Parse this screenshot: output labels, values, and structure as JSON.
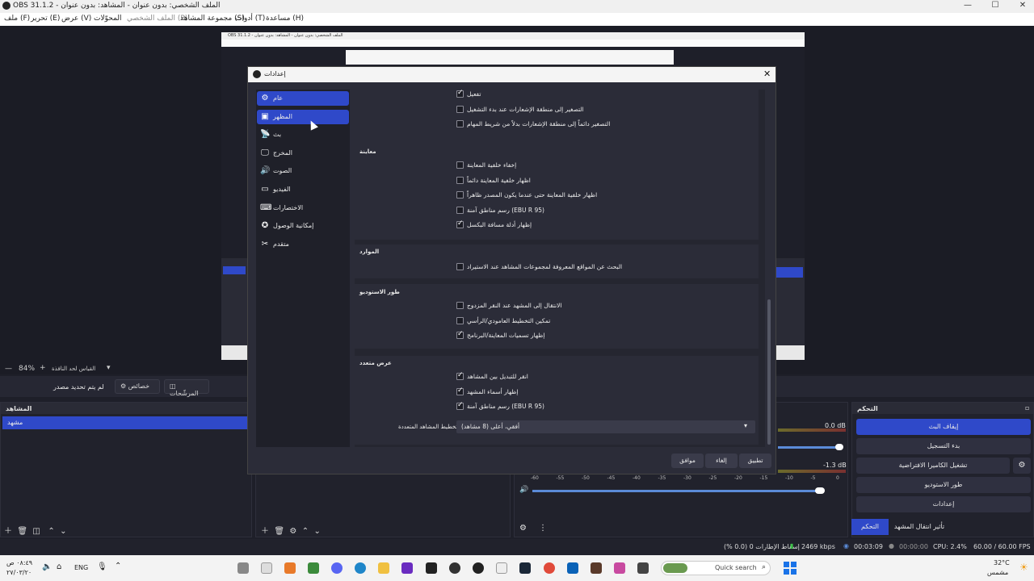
{
  "window": {
    "title": "OBS 31.1.2 - الملف الشخصي: بدون عنوان - المشاهد: بدون عنوان"
  },
  "menu": [
    "ملف (F)",
    "تحرير (E)",
    "عرض (V)",
    "المحوّلات",
    "الملف الشخصي (P)",
    "مجموعة المشاهد (S)",
    "أدوات (T)",
    "مساعدة (H)"
  ],
  "preview_title": "OBS 31.1.2 - الملف الشخصي: بدون عنوان - المشاهد: بدون عنوان",
  "zoom": {
    "value": "84%",
    "label": "القياس لحد النافذة"
  },
  "sourcebar": {
    "no_source": "لم يتم تحديد مصدر",
    "properties": "خصائص",
    "filters": "المرشّحات"
  },
  "scenes_panel": {
    "title": "المشاهد",
    "item": "مشهد"
  },
  "controls": {
    "title": "التحكم",
    "buttons": [
      "إيقاف البث",
      "بدء التسجيل",
      "تشغيل الكاميرا الافتراضية",
      "طور الاستوديو",
      "إعدادات"
    ],
    "tab_controls": "التحكم",
    "tab_transitions": "تأثير انتقال المشهد"
  },
  "audio": {
    "db1": "0.0 dB",
    "db2": "-1.3 dB",
    "ticks": [
      "-60",
      "-55",
      "-50",
      "-45",
      "-40",
      "-35",
      "-30",
      "-25",
      "-20",
      "-15",
      "-10",
      "-5",
      "0"
    ]
  },
  "dialog": {
    "title": "إعدادات",
    "nav": [
      {
        "icon": "gear",
        "glyph": "⚙",
        "label": "عام"
      },
      {
        "icon": "appearance",
        "glyph": "▣",
        "label": "المظهر"
      },
      {
        "icon": "broadcast",
        "glyph": "📡",
        "label": "بث"
      },
      {
        "icon": "output",
        "glyph": "🖵",
        "label": "المخرج"
      },
      {
        "icon": "audio",
        "glyph": "🔊",
        "label": "الصوت"
      },
      {
        "icon": "video",
        "glyph": "▭",
        "label": "الفيديو"
      },
      {
        "icon": "keyboard",
        "glyph": "⌨",
        "label": "الاختصارات"
      },
      {
        "icon": "accessibility",
        "glyph": "✪",
        "label": "إمكانية الوصول"
      },
      {
        "icon": "advanced",
        "glyph": "✂",
        "label": "متقدم"
      }
    ],
    "group_top": {
      "items": [
        {
          "label": "تفعيل",
          "checked": true
        },
        {
          "label": "التصغير إلى منطقة الإشعارات عند بدء التشغيل",
          "checked": false
        },
        {
          "label": "التصغير دائماً إلى منطقة الإشعارات بدلاً من شريط المهام",
          "checked": false
        }
      ]
    },
    "group_preview": {
      "title": "معاينة",
      "items": [
        {
          "label": "إخفاء خلفية المعاينة",
          "checked": false
        },
        {
          "label": "اظهار خلفية المعاينة دائماً",
          "checked": false
        },
        {
          "label": "اظهار خلفية المعاينة حتى عندما يكون المصدر ظاهراً",
          "checked": false
        },
        {
          "label": "رسم مناطق آمنة (EBU R 95)",
          "checked": false
        },
        {
          "label": "إظهار أدلة مسافة البكسل",
          "checked": true
        }
      ]
    },
    "group_sources": {
      "title": "الموارد",
      "items": [
        {
          "label": "البحث عن المواقع المعروفة لمجموعات المشاهد عند الاستيراد",
          "checked": false
        }
      ]
    },
    "group_studio": {
      "title": "طور الاستوديو",
      "items": [
        {
          "label": "الانتقال إلى المشهد عند النقر المزدوج",
          "checked": false
        },
        {
          "label": "تمكين التخطيط العامودي/الرأسي",
          "checked": false
        },
        {
          "label": "إظهار تسميات المعاينة/البرنامج",
          "checked": true
        }
      ]
    },
    "group_multiview": {
      "title": "عرض متعدد",
      "items": [
        {
          "label": "انقر للتبديل بين المشاهد",
          "checked": true
        },
        {
          "label": "إظهار أسماء المشهد",
          "checked": true
        },
        {
          "label": "رسم مناطق آمنة (EBU R 95)",
          "checked": true
        }
      ],
      "layout_label": "تخطيط المشاهد المتعددة",
      "layout_value": "أفقي، أعلى (8 مشاهد)"
    },
    "buttons": {
      "ok": "موافق",
      "cancel": "إلغاء",
      "apply": "تطبيق"
    }
  },
  "status": {
    "dropped": "إسقاط الإطارات 0 (0.0 %)",
    "kbps": "2469 kbps",
    "time1": "00:03:09",
    "time2": "00:00:00",
    "cpu": "CPU: 2.4%",
    "fps": "60.00 / 60.00 FPS"
  },
  "taskbar": {
    "time": "٠٨:٤٩ ص",
    "date": "٢٧/٠٣/٢٠",
    "lang": "ENG",
    "search": "Quick search",
    "temp": "32°C",
    "weather": "مشمس"
  }
}
